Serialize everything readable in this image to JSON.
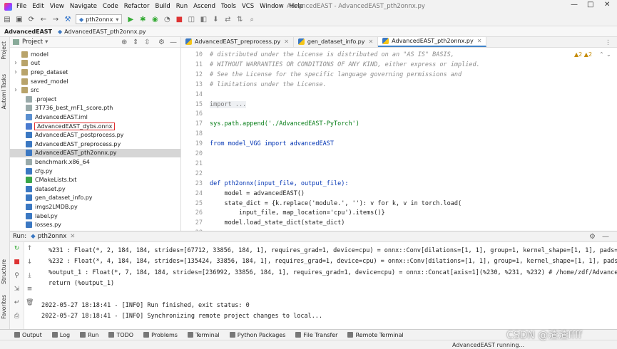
{
  "menubar": {
    "items": [
      "File",
      "Edit",
      "View",
      "Navigate",
      "Code",
      "Refactor",
      "Build",
      "Run",
      "Ascend",
      "Tools",
      "VCS",
      "Window",
      "Help"
    ],
    "title": "AdvancedEAST - AdvancedEAST_pth2onnx.py",
    "minimize": "—",
    "maximize": "□",
    "close": "✕"
  },
  "toolbar": {
    "run_config": "pth2onnx"
  },
  "breadcrumb": {
    "project": "AdvancedEAST",
    "file": "AdvancedEAST_pth2onnx.py"
  },
  "left_strip": {
    "project_tab": "Project",
    "automl_tab": "AutomI Tasks",
    "structure_tab": "Structure",
    "favorites_tab": "Favorites"
  },
  "project_panel": {
    "title": "Project",
    "items": [
      {
        "label": "model",
        "type": "folder",
        "depth": 1,
        "expandable": false
      },
      {
        "label": "out",
        "type": "folder",
        "depth": 1,
        "expandable": true
      },
      {
        "label": "prep_dataset",
        "type": "folder",
        "depth": 1,
        "expandable": true
      },
      {
        "label": "saved_model",
        "type": "folder",
        "depth": 1,
        "expandable": false
      },
      {
        "label": "src",
        "type": "folder",
        "depth": 1,
        "expandable": true
      },
      {
        "label": ".project",
        "type": "file",
        "depth": 1
      },
      {
        "label": "3T736_best_mF1_score.pth",
        "type": "file",
        "depth": 1
      },
      {
        "label": "AdvancedEAST.iml",
        "type": "iml",
        "depth": 1
      },
      {
        "label": "AdvancedEAST_dybs.onnx",
        "type": "onnx",
        "depth": 1,
        "highlighted": true
      },
      {
        "label": "AdvancedEAST_postprocess.py",
        "type": "py",
        "depth": 1
      },
      {
        "label": "AdvancedEAST_preprocess.py",
        "type": "py",
        "depth": 1
      },
      {
        "label": "AdvancedEAST_pth2onnx.py",
        "type": "py",
        "depth": 1,
        "selected": true
      },
      {
        "label": "benchmark.x86_64",
        "type": "file",
        "depth": 1
      },
      {
        "label": "cfg.py",
        "type": "py",
        "depth": 1
      },
      {
        "label": "CMakeLists.txt",
        "type": "cmake",
        "depth": 1
      },
      {
        "label": "dataset.py",
        "type": "py",
        "depth": 1
      },
      {
        "label": "gen_dataset_info.py",
        "type": "py",
        "depth": 1
      },
      {
        "label": "imgs2LMDB.py",
        "type": "py",
        "depth": 1
      },
      {
        "label": "label.py",
        "type": "py",
        "depth": 1
      },
      {
        "label": "losses.py",
        "type": "py",
        "depth": 1
      }
    ]
  },
  "editor": {
    "tabs": [
      {
        "label": "AdvancedEAST_preprocess.py",
        "active": false
      },
      {
        "label": "gen_dataset_info.py",
        "active": false
      },
      {
        "label": "AdvancedEAST_pth2onnx.py",
        "active": true
      }
    ],
    "warnings": "▲2  ▲2",
    "line_numbers": [
      "10",
      "11",
      "12",
      "13",
      "14",
      "15",
      "16",
      "17",
      "18",
      "19",
      "20",
      "21",
      "22",
      "23",
      "24",
      "25",
      "26",
      "27",
      "28"
    ],
    "lines": [
      "# distributed under the License is distributed on an \"AS IS\" BASIS,",
      "# WITHOUT WARRANTIES OR CONDITIONS OF ANY KIND, either express or implied.",
      "# See the License for the specific language governing permissions and",
      "# limitations under the License.",
      "",
      "import ...",
      "",
      "sys.path.append('./AdvancedEAST-PyTorch')",
      "",
      "from model_VGG import advancedEAST",
      "",
      "",
      "",
      "def pth2onnx(input_file, output_file):",
      "    model = advancedEAST()",
      "    state_dict = {k.replace('module.', ''): v for k, v in torch.load(",
      "        input_file, map_location='cpu').items()}",
      "    model.load_state_dict(state_dict)",
      ""
    ]
  },
  "run_panel": {
    "label": "Run:",
    "config": "pth2onnx",
    "output": [
      "%231 : Float(*, 2, 184, 184, strides=[67712, 33856, 184, 1], requires_grad=1, device=cpu) = onnx::Conv[dilations=[1, 1], group=1, kernel_shape=[1, 1], pads=[",
      "%232 : Float(*, 4, 184, 184, strides=[135424, 33856, 184, 1], requires_grad=1, device=cpu) = onnx::Conv[dilations=[1, 1], group=1, kernel_shape=[1, 1], pads=",
      "%output_1 : Float(*, 7, 184, 184, strides=[236992, 33856, 184, 1], requires_grad=1, device=cpu) = onnx::Concat[axis=1](%230, %231, %232) # /home/zdf/Advanced",
      "return (%output_1)",
      "",
      "2022-05-27 18:18:41 - [INFO] Run finished, exit status: 0",
      "2022-05-27 18:18:41 - [INFO] Synchronizing remote project changes to local..."
    ]
  },
  "bottom_tabs": [
    "Output",
    "Log",
    "Run",
    "TODO",
    "Problems",
    "Terminal",
    "Python Packages",
    "File Transfer",
    "Remote Terminal"
  ],
  "statusbar": {
    "text": "AdvancedEAST running..."
  },
  "watermark": "CSDN @渣渣ffff"
}
